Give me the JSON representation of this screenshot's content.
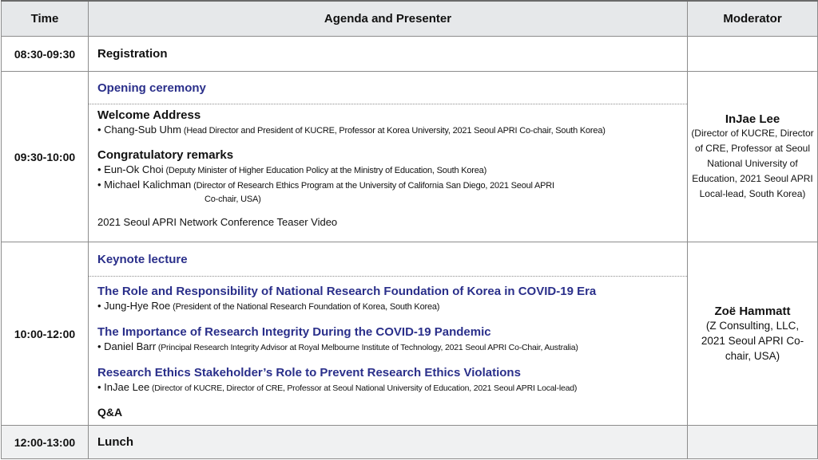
{
  "header": {
    "time": "Time",
    "agenda": "Agenda and Presenter",
    "moderator": "Moderator"
  },
  "rows": {
    "registration": {
      "time": "08:30-09:30",
      "title": "Registration"
    },
    "opening": {
      "time": "09:30-10:00",
      "section": "Opening ceremony",
      "welcome_title": "Welcome Address",
      "welcome_name": "• Chang-Sub Uhm",
      "welcome_detail": " (Head Director and President of KUCRE, Professor at Korea University, 2021 Seoul APRI Co-chair, South Korea)",
      "congrats_title": "Congratulatory remarks",
      "c1_name": "• Eun-Ok Choi",
      "c1_detail": " (Deputy Minister of Higher Education Policy at the Ministry of Education, South Korea)",
      "c2_name": "• Michael Kalichman",
      "c2_detail": " (Director of Research Ethics Program at the University of California San Diego, 2021 Seoul APRI",
      "c2_detail2": "Co-chair, USA)",
      "video": "2021 Seoul APRI Network Conference Teaser Video",
      "moderator_name": "InJae Lee",
      "moderator_aff": "(Director of KUCRE, Director of CRE, Professor at Seoul National University of Education, 2021 Seoul APRI Local-lead, South Korea)"
    },
    "keynote": {
      "time": "10:00-12:00",
      "section": "Keynote lecture",
      "t1": "The Role and Responsibility of National Research Foundation of Korea in COVID-19 Era",
      "t1_name": "• Jung-Hye Roe",
      "t1_detail": " (President of the National Research Foundation of Korea, South Korea)",
      "t2": "The Importance of Research Integrity During the COVID-19 Pandemic",
      "t2_name": "• Daniel Barr",
      "t2_detail": " (Principal Research Integrity Advisor at Royal Melbourne Institute of Technology, 2021 Seoul APRI Co-Chair, Australia)",
      "t3": "Research Ethics Stakeholder’s Role to Prevent Research Ethics Violations",
      "t3_name": "• InJae Lee",
      "t3_detail": " (Director of KUCRE, Director of CRE, Professor at Seoul National University of Education, 2021 Seoul APRI Local-lead)",
      "qa": "Q&A",
      "moderator_name": "Zoë Hammatt",
      "moderator_aff": "(Z Consulting, LLC, 2021 Seoul APRI Co-chair, USA)"
    },
    "lunch": {
      "time": "12:00-13:00",
      "title": "Lunch"
    }
  }
}
